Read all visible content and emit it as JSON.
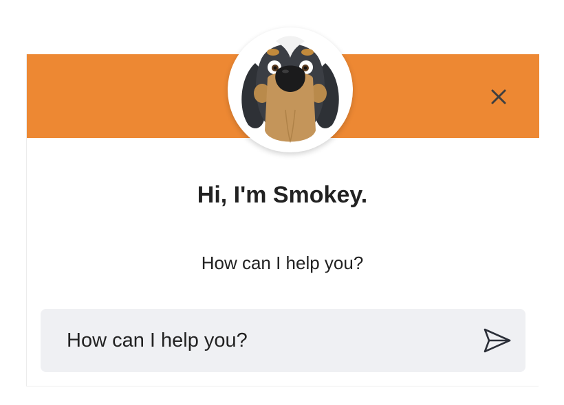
{
  "header": {
    "background_color": "#ed8833",
    "close_icon": "close-icon",
    "avatar_icon": "dog-mascot-avatar"
  },
  "greeting": {
    "title": "Hi, I'm Smokey.",
    "subtitle": "How can I help you?"
  },
  "composer": {
    "placeholder": "How can I help you?",
    "send_icon": "send-icon",
    "background_color": "#eff0f3"
  }
}
